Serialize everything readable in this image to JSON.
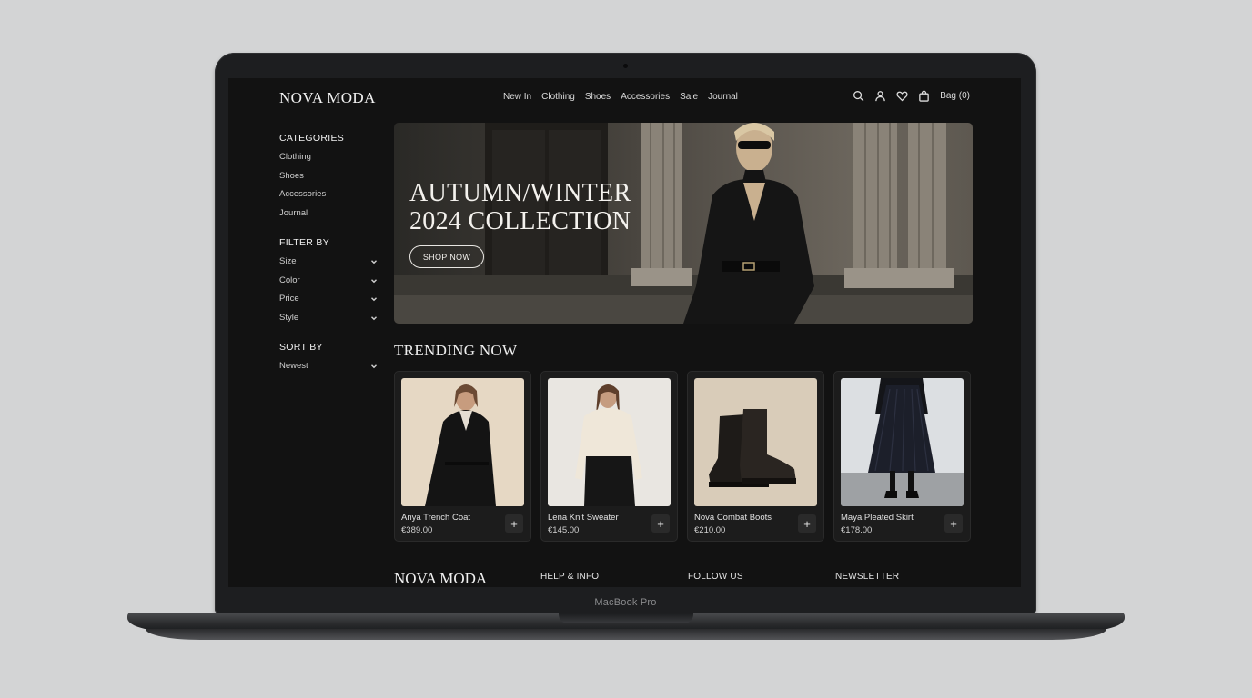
{
  "device": {
    "label": "MacBook Pro"
  },
  "header": {
    "logo": "NOVA MODA",
    "nav": [
      "New In",
      "Clothing",
      "Shoes",
      "Accessories",
      "Sale",
      "Journal"
    ],
    "bag_label": "Bag (0)",
    "icons": [
      "search-icon",
      "account-icon",
      "heart-icon",
      "bag-icon"
    ]
  },
  "sidebar": {
    "categories_title": "CATEGORIES",
    "categories": [
      "Clothing",
      "Shoes",
      "Accessories",
      "Journal"
    ],
    "filter_title": "FILTER BY",
    "filters": [
      "Size",
      "Color",
      "Price",
      "Style"
    ],
    "sort_title": "SORT BY",
    "sort_value": "Newest"
  },
  "hero": {
    "title_line1": "AUTUMN/WINTER",
    "title_line2": "2024 COLLECTION",
    "cta": "SHOP NOW"
  },
  "trending": {
    "title": "TRENDING NOW",
    "products": [
      {
        "name": "Anya Trench Coat",
        "price": "€389.00"
      },
      {
        "name": "Lena Knit Sweater",
        "price": "€145.00"
      },
      {
        "name": "Nova Combat Boots",
        "price": "€210.00"
      },
      {
        "name": "Maya Pleated Skirt",
        "price": "€178.00"
      }
    ]
  },
  "footer": {
    "logo": "NOVA MODA",
    "columns": [
      "HELP & INFO",
      "FOLLOW US",
      "NEWSLETTER"
    ]
  },
  "colors": {
    "page_bg": "#121212",
    "card_bg": "#1c1c1c",
    "text": "#e8e8e8"
  }
}
